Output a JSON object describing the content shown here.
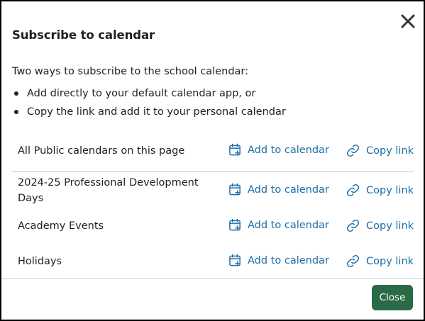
{
  "modal": {
    "title": "Subscribe to calendar",
    "close_icon": "close-x-icon",
    "intro": "Two ways to subscribe to the school calendar:",
    "bullets": [
      "Add directly to your default calendar app, or",
      "Copy the link and add it to your personal calendar"
    ],
    "calendars": [
      {
        "name": "All Public calendars on this page",
        "add_label": "Add to calendar",
        "copy_label": "Copy link"
      },
      {
        "name": "2024-25 Professional Development Days",
        "add_label": "Add to calendar",
        "copy_label": "Copy link"
      },
      {
        "name": "Academy Events",
        "add_label": "Add to calendar",
        "copy_label": "Copy link"
      },
      {
        "name": "Holidays",
        "add_label": "Add to calendar",
        "copy_label": "Copy link"
      }
    ],
    "add_icon": "calendar-add-icon",
    "copy_icon": "link-icon",
    "close_button_label": "Close"
  },
  "colors": {
    "link": "#1a6ea8",
    "close_button_bg": "#2a6b47",
    "border": "#000000"
  }
}
